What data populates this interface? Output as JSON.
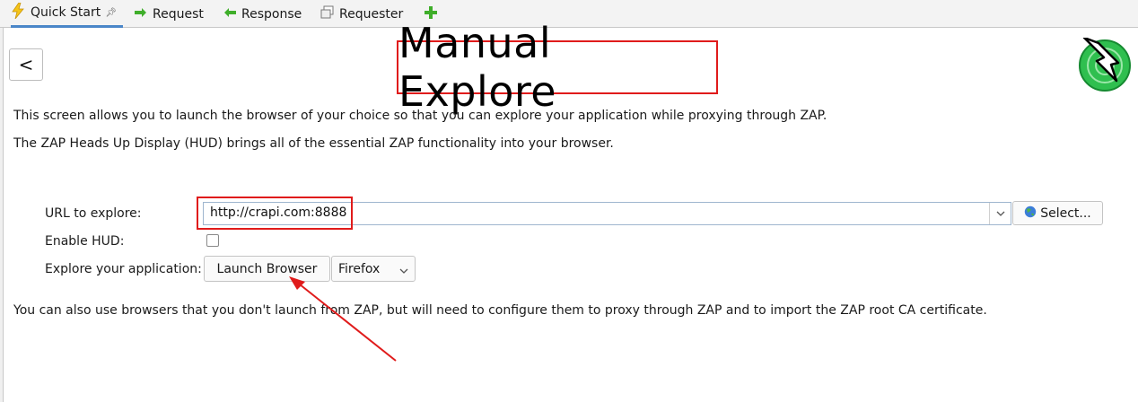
{
  "tabs": [
    {
      "label": "Quick Start",
      "icon": "lightning-icon",
      "pinned": true,
      "active": true
    },
    {
      "label": "Request",
      "icon": "arrow-right-icon"
    },
    {
      "label": "Response",
      "icon": "arrow-left-icon"
    },
    {
      "label": "Requester",
      "icon": "requester-icon"
    },
    {
      "label": "",
      "icon": "add-tab-icon"
    }
  ],
  "back_button_label": "<",
  "page_title": "Manual Explore",
  "intro": {
    "line1": "This screen allows you to launch the browser of your choice so that you can explore your application while proxying through ZAP.",
    "line2": "The ZAP Heads Up Display (HUD) brings all of the essential ZAP functionality into your browser."
  },
  "form": {
    "url_label": "URL to explore:",
    "url_value": "http://crapi.com:8888",
    "select_button": "Select...",
    "hud_label": "Enable HUD:",
    "hud_checked": false,
    "explore_label": "Explore your application:",
    "launch_button": "Launch Browser",
    "browser_selected": "Firefox"
  },
  "footer_note": "You can also use browsers that you don't launch from ZAP, but will need to configure them to proxy through ZAP and to import the ZAP root CA certificate.",
  "colors": {
    "annotation_red": "#e01b1b",
    "tab_active_underline": "#4a86c8",
    "logo_green": "#2fbf4f"
  }
}
